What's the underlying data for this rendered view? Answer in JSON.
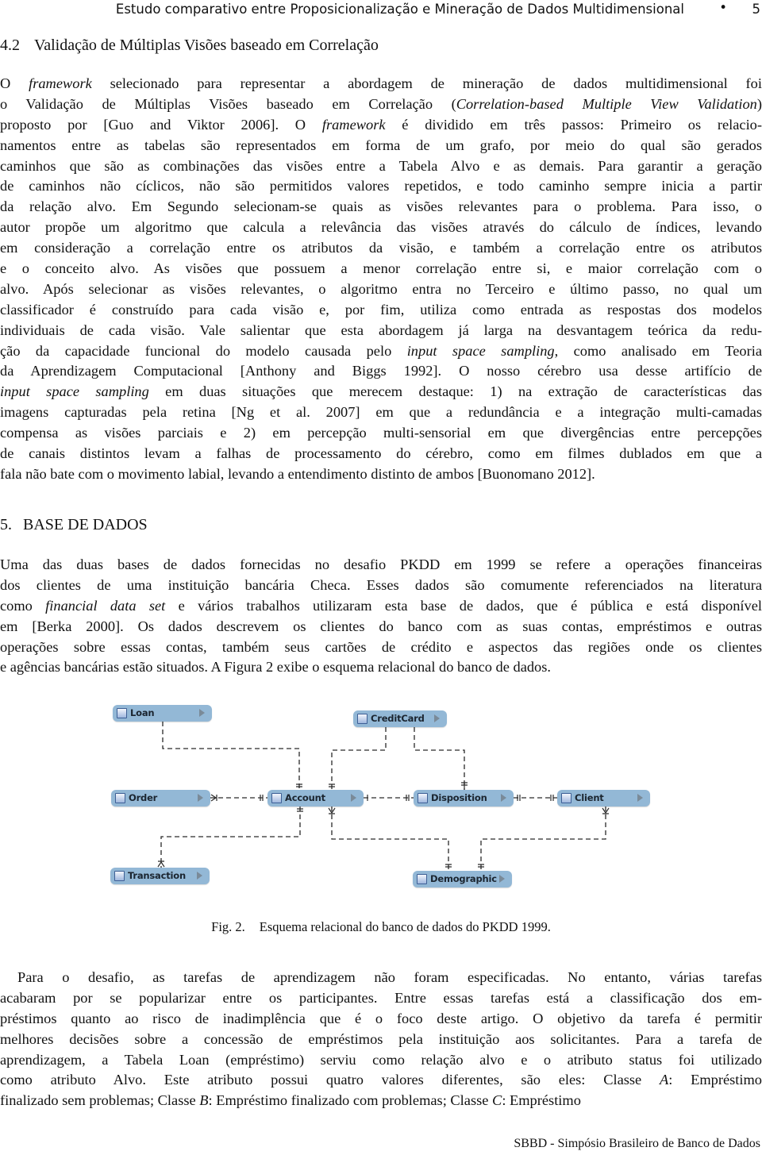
{
  "running_head": {
    "title": "Estudo comparativo entre Proposicionalização e Mineração de Dados Multidimensional",
    "separator": "•",
    "page_number": "5"
  },
  "section_4_2": {
    "number": "4.2",
    "title": "Validação de Múltiplas Visões baseado em Correlação"
  },
  "paragraph_1": {
    "lines": [
      [
        "O ",
        {
          "i": "framework"
        },
        " selecionado para representar a abordagem de mineração de dados multidimensional foi"
      ],
      [
        "o Validação de Múltiplas Visões baseado em Correlação (",
        {
          "i": "Correlation-based Multiple View Validation"
        },
        ")"
      ],
      [
        "proposto por [Guo and Viktor 2006].  O ",
        {
          "i": "framework"
        },
        " é dividido em três passos: Primeiro os relacio-"
      ],
      [
        "namentos entre as tabelas são representados em forma de um grafo, por meio do qual são gerados"
      ],
      [
        "caminhos que são as combinações das visões entre a Tabela Alvo e as demais. Para garantir a geração"
      ],
      [
        "de caminhos não cíclicos, não são permitidos valores repetidos, e todo caminho sempre inicia a partir"
      ],
      [
        "da relação alvo. Em Segundo selecionam-se quais as visões relevantes para o problema. Para isso, o"
      ],
      [
        "autor propõe um algoritmo que calcula a relevância das visões através do cálculo de índices, levando"
      ],
      [
        "em consideração a correlação entre os atributos da visão, e também a correlação entre os atributos"
      ],
      [
        "e o conceito alvo.  As visões que possuem a menor correlação entre si, e maior correlação com o"
      ],
      [
        "alvo. Após selecionar as visões relevantes, o algoritmo entra no Terceiro e último passo, no qual um"
      ],
      [
        "classificador é construído para cada visão e, por fim, utiliza como entrada as respostas dos modelos"
      ],
      [
        "individuais de cada visão. Vale salientar que esta abordagem já larga na desvantagem teórica da redu-"
      ],
      [
        "ção da capacidade funcional do modelo causada pelo ",
        {
          "i": "input space sampling"
        },
        ", como analisado em Teoria"
      ],
      [
        "da Aprendizagem Computacional [Anthony and Biggs 1992].  O nosso cérebro usa desse artifício de"
      ],
      [
        {
          "i": "input space sampling"
        },
        " em duas situações que merecem destaque: 1) na extração de características das"
      ],
      [
        "imagens capturadas pela retina [Ng et  al. 2007] em que a redundância e a integração multi-camadas"
      ],
      [
        "compensa as visões parciais e 2) em percepção multi-sensorial em que divergências entre percepções"
      ],
      [
        "de canais distintos levam a falhas de processamento do cérebro, como em filmes dublados em que a"
      ],
      [
        "fala não bate com o movimento labial, levando a entendimento distinto de ambos [Buonomano 2012]."
      ]
    ]
  },
  "section_5": {
    "number": "5.",
    "title": "BASE DE DADOS"
  },
  "paragraph_2": {
    "lines": [
      [
        "Uma das duas bases de dados fornecidas no desafio PKDD em 1999 se refere a operações financeiras"
      ],
      [
        "dos clientes de uma instituição bancária Checa. Esses dados são comumente referenciados na literatura"
      ],
      [
        "como ",
        {
          "i": "financial data set"
        },
        " e vários trabalhos utilizaram esta base de dados, que é pública e está disponível"
      ],
      [
        "em [Berka 2000]. Os dados descrevem os clientes do banco com as suas contas, empréstimos e outras"
      ],
      [
        "operações sobre essas contas, também seus cartões de crédito e aspectos das regiões onde os clientes"
      ],
      [
        "e agências bancárias estão situados.  A Figura 2 exibe o esquema relacional do banco de dados."
      ]
    ]
  },
  "figure": {
    "entities": [
      {
        "id": "loan",
        "label": "Loan"
      },
      {
        "id": "creditcard",
        "label": "CreditCard"
      },
      {
        "id": "order",
        "label": "Order"
      },
      {
        "id": "account",
        "label": "Account"
      },
      {
        "id": "disposition",
        "label": "Disposition"
      },
      {
        "id": "client",
        "label": "Client"
      },
      {
        "id": "transaction",
        "label": "Transaction"
      },
      {
        "id": "demographic",
        "label": "Demographic"
      }
    ],
    "relationships": [
      {
        "from": "account",
        "to": "loan",
        "from_cardinality": "one",
        "to_cardinality": "many"
      },
      {
        "from": "account",
        "to": "creditcard",
        "from_cardinality": "one",
        "to_cardinality": "many"
      },
      {
        "from": "disposition",
        "to": "creditcard",
        "from_cardinality": "one",
        "to_cardinality": "one"
      },
      {
        "from": "account",
        "to": "order",
        "from_cardinality": "one",
        "to_cardinality": "many"
      },
      {
        "from": "account",
        "to": "disposition",
        "from_cardinality": "one",
        "to_cardinality": "one"
      },
      {
        "from": "disposition",
        "to": "client",
        "from_cardinality": "one",
        "to_cardinality": "one"
      },
      {
        "from": "account",
        "to": "transaction",
        "from_cardinality": "one",
        "to_cardinality": "many"
      },
      {
        "from": "demographic",
        "to": "account",
        "from_cardinality": "one",
        "to_cardinality": "many"
      },
      {
        "from": "demographic",
        "to": "client",
        "from_cardinality": "one",
        "to_cardinality": "many"
      }
    ],
    "entity_color": "#93b8d6",
    "caption_label": "Fig. 2.",
    "caption_text": "Esquema relacional do banco de dados do PKDD 1999."
  },
  "paragraph_3": {
    "lines": [
      [
        "Para o desafio, as tarefas de aprendizagem não foram especificadas.  No entanto, várias tarefas"
      ],
      [
        "acabaram por se popularizar entre os participantes. Entre essas tarefas está a classificação dos em-"
      ],
      [
        "préstimos quanto ao risco de inadimplência que é o foco deste artigo. O objetivo da tarefa é permitir"
      ],
      [
        "melhores decisões sobre a concessão de empréstimos pela instituição aos solicitantes. Para a tarefa de"
      ],
      [
        "aprendizagem, a Tabela Loan (empréstimo) serviu como relação alvo e o atributo status foi utilizado"
      ],
      [
        "como atributo Alvo. Este atributo possui quatro valores diferentes, são eles: Classe ",
        {
          "i": "A"
        },
        ": Empréstimo"
      ],
      [
        "finalizado sem problemas; Classe ",
        {
          "i": "B"
        },
        ": Empréstimo finalizado com problemas; Classe ",
        {
          "i": "C"
        },
        ": Empréstimo"
      ]
    ]
  },
  "footer": {
    "text": "SBBD - Simpósio Brasileiro de Banco de Dados"
  }
}
